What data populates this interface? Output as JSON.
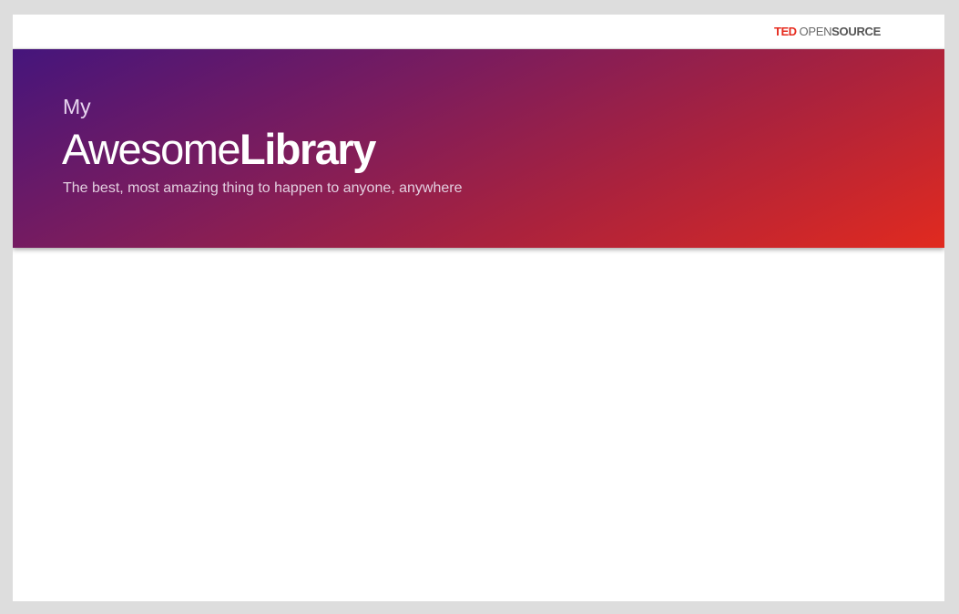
{
  "brand": {
    "logo_ted": "TED",
    "logo_open": "OPEN",
    "logo_source": "SOURCE"
  },
  "hero": {
    "eyebrow": "My",
    "title_light": "Awesome",
    "title_bold": "Library",
    "tagline": "The best, most amazing thing to happen to anyone, anywhere"
  },
  "colors": {
    "background": "#dddddd",
    "brand_red": "#e62b1e",
    "gradient_start": "#45157c",
    "gradient_end": "#e12a1f"
  }
}
